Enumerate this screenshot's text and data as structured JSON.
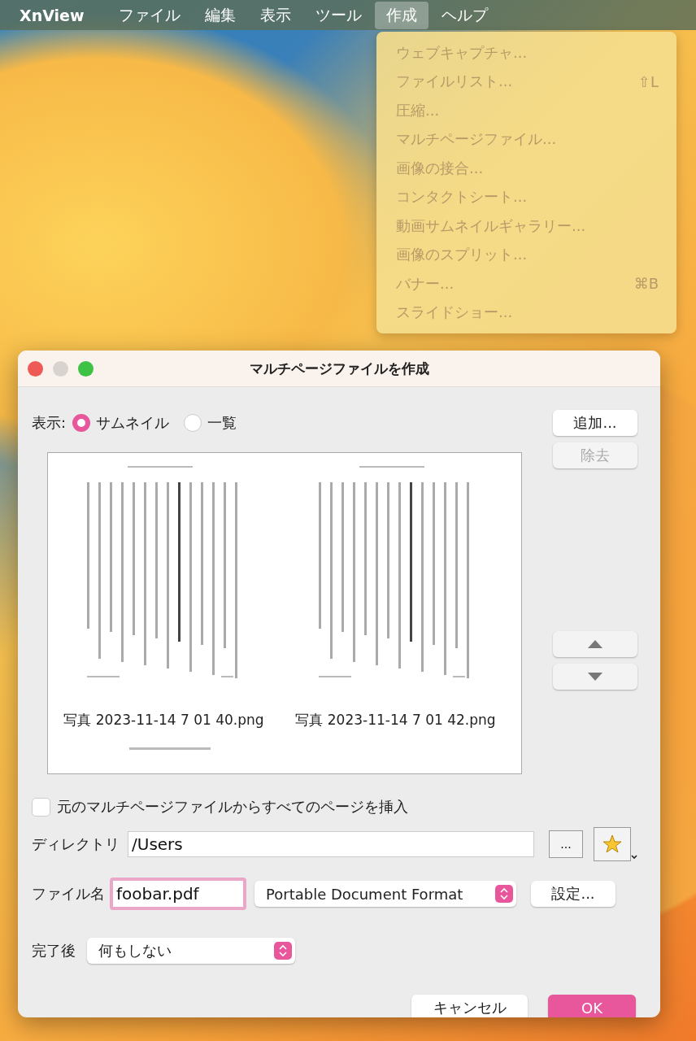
{
  "menu_bar": {
    "app_name": "XnView",
    "items": [
      {
        "label": "ファイル",
        "selected": false
      },
      {
        "label": "編集",
        "selected": false
      },
      {
        "label": "表示",
        "selected": false
      },
      {
        "label": "ツール",
        "selected": false
      },
      {
        "label": "作成",
        "selected": true
      },
      {
        "label": "ヘルプ",
        "selected": false
      }
    ]
  },
  "dropdown_menu": {
    "items": [
      {
        "label": "ウェブキャプチャ...",
        "disabled": true
      },
      {
        "label": "ファイルリスト...",
        "shortcut": "⇧L",
        "disabled": true
      },
      {
        "label": "圧縮...",
        "disabled": true
      },
      {
        "label": "マルチページファイル...",
        "disabled": true
      },
      {
        "label": "画像の接合...",
        "disabled": true
      },
      {
        "label": "コンタクトシート...",
        "disabled": true
      },
      {
        "label": "動画サムネイルギャラリー...",
        "disabled": true
      },
      {
        "label": "画像のスプリット...",
        "disabled": true
      },
      {
        "label": "バナー...",
        "shortcut": "⌘B",
        "disabled": true
      },
      {
        "label": "スライドショー...",
        "disabled": true
      }
    ]
  },
  "dialog": {
    "title": "マルチページファイルを作成",
    "view_label": "表示:",
    "view_options": [
      {
        "label": "サムネイル",
        "selected": true
      },
      {
        "label": "一覧",
        "selected": false
      }
    ],
    "side_buttons": [
      {
        "label": "追加...",
        "disabled": false
      },
      {
        "label": "除去",
        "disabled": true
      }
    ],
    "thumbnails": [
      {
        "caption": "写真 2023-11-14 7 01 40.png"
      },
      {
        "caption": "写真 2023-11-14 7 01 42.png"
      }
    ],
    "insert_all_pages": {
      "label": "元のマルチページファイルからすべてのページを挿入",
      "checked": false
    },
    "directory": {
      "label": "ディレクトリ",
      "value": "/Users",
      "browse_button": "..."
    },
    "filename": {
      "label": "ファイル名",
      "value": "foobar.pdf",
      "format": "Portable Document Format",
      "settings_button": "設定..."
    },
    "after_completion": {
      "label": "完了後",
      "value": "何もしない"
    },
    "buttons": [
      {
        "label": "キャンセル",
        "kind": "secondary"
      },
      {
        "label": "OK",
        "kind": "primary"
      }
    ]
  }
}
